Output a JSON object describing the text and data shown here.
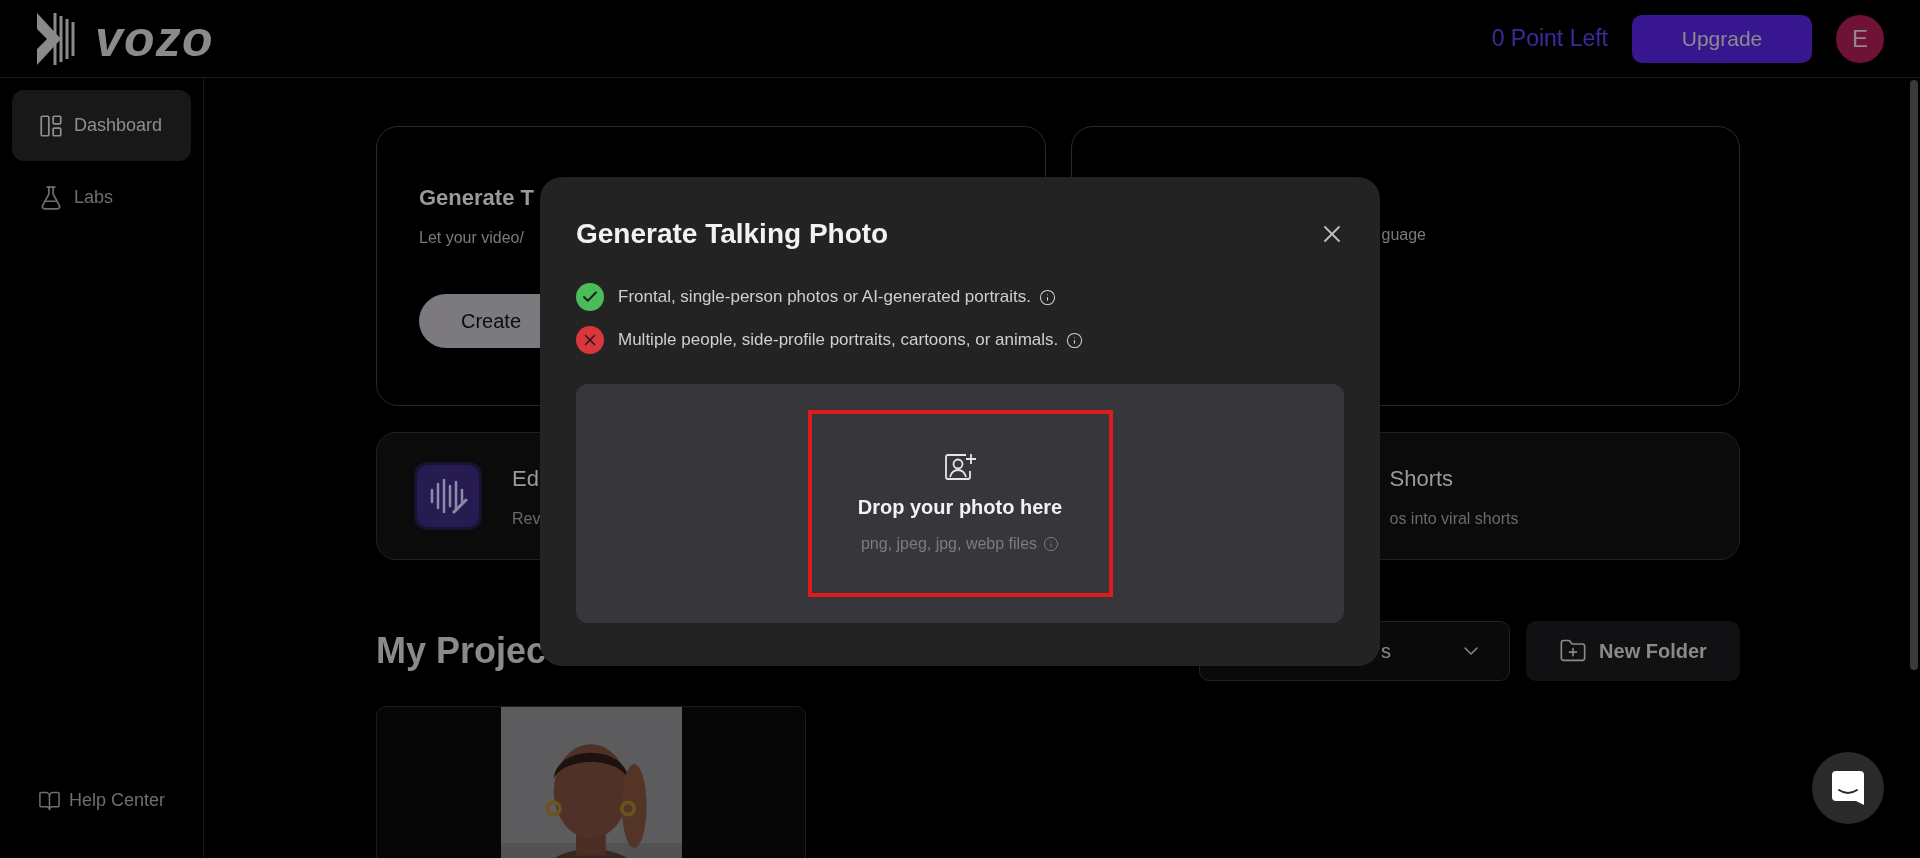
{
  "header": {
    "logo_text": "vozo",
    "points": "0 Point Left",
    "upgrade": "Upgrade",
    "avatar": "E"
  },
  "sidebar": {
    "items": [
      {
        "label": "Dashboard",
        "selected": true
      },
      {
        "label": "Labs",
        "selected": false
      }
    ],
    "footer": "Help Center"
  },
  "feature_cards": [
    {
      "title": "Generate T",
      "subtitle": "Let your video/",
      "button": "Create"
    },
    {
      "subtitle": "guage"
    }
  ],
  "tool_cards": [
    {
      "title": "Ed",
      "subtitle": "Rev"
    },
    {
      "title": "Shorts",
      "subtitle": "os into viral shorts"
    }
  ],
  "projects": {
    "title": "My Projec",
    "filter": "s",
    "new_folder": "New Folder"
  },
  "modal": {
    "title": "Generate Talking Photo",
    "rules": [
      {
        "allowed": true,
        "text": "Frontal, single-person photos or AI-generated portraits."
      },
      {
        "allowed": false,
        "text": "Multiple people, side-profile portraits, cartoons, or animals."
      }
    ],
    "dropzone": {
      "title": "Drop your photo here",
      "hint": "png, jpeg, jpg, webp files",
      "highlighted": true
    }
  }
}
